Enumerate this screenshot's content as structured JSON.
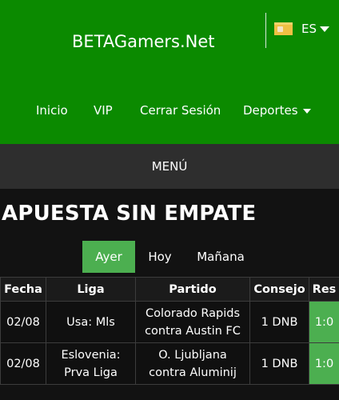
{
  "header": {
    "brand": "BETAGamers.Net",
    "language": {
      "code": "ES",
      "flag_icon": "spain-flag-icon"
    },
    "nav": [
      {
        "label": "Inicio"
      },
      {
        "label": "VIP"
      },
      {
        "label": "Cerrar Sesión"
      },
      {
        "label": "Deportes"
      }
    ]
  },
  "menu_label": "MENÚ",
  "page_title": "APUESTA SIN EMPATE",
  "tabs": [
    {
      "label": "Ayer",
      "active": true
    },
    {
      "label": "Hoy",
      "active": false
    },
    {
      "label": "Mañana",
      "active": false
    }
  ],
  "table": {
    "columns": [
      "Fecha",
      "Liga",
      "Partido",
      "Consejo",
      "Res"
    ],
    "rows": [
      {
        "fecha": "02/08",
        "liga_1": "Usa: Mls",
        "liga_2": "",
        "partido_1": "Colorado Rapids",
        "partido_2": "contra Austin FC",
        "consejo": "1 DNB",
        "res": "1:0"
      },
      {
        "fecha": "02/08",
        "liga_1": "Eslovenia:",
        "liga_2": "Prva Liga",
        "partido_1": "O. Ljubljana",
        "partido_2": "contra Aluminij",
        "consejo": "1 DNB",
        "res": "1:0"
      }
    ]
  },
  "colors": {
    "header_green": "#0b8a00",
    "accent_green": "#4caf50",
    "menu_bar": "#2e2e2e",
    "background": "#121212"
  }
}
